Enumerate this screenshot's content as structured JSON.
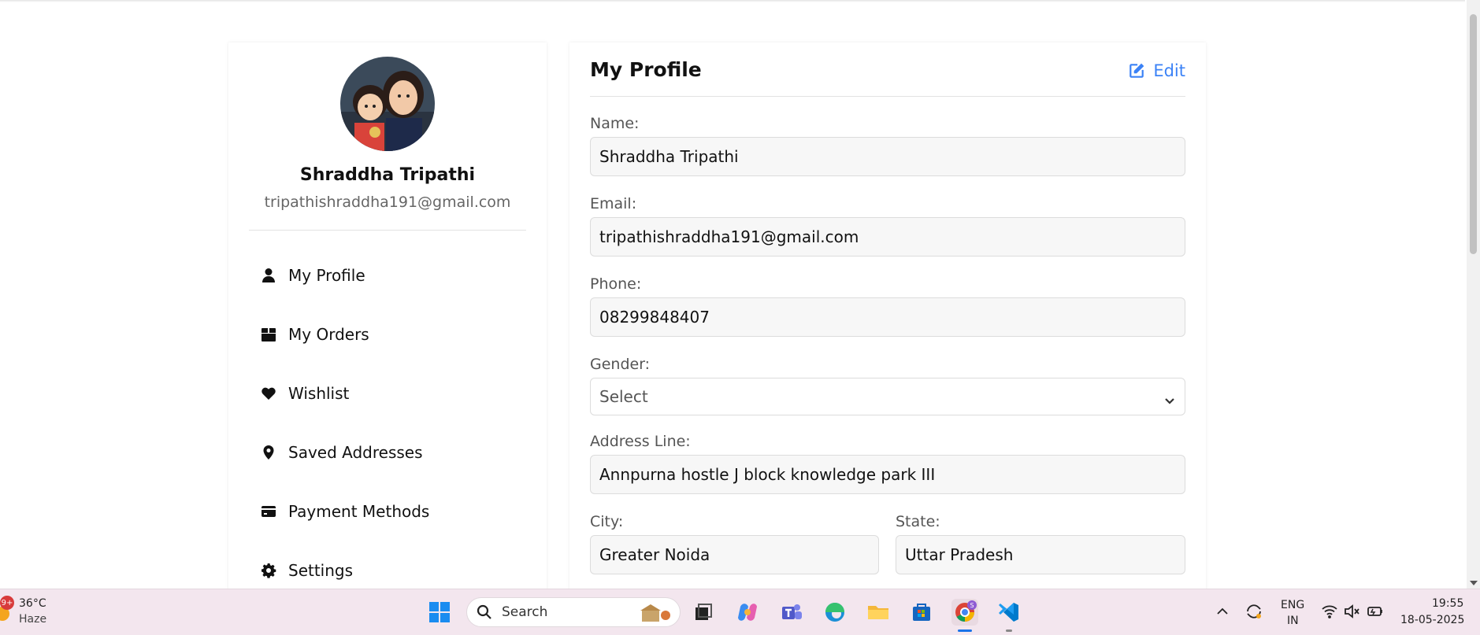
{
  "user": {
    "name": "Shraddha Tripathi",
    "email": "tripathishraddha191@gmail.com"
  },
  "sidebar": {
    "items": [
      {
        "label": "My Profile",
        "icon": "user-icon"
      },
      {
        "label": "My Orders",
        "icon": "box-icon"
      },
      {
        "label": "Wishlist",
        "icon": "heart-icon"
      },
      {
        "label": "Saved Addresses",
        "icon": "map-pin-icon"
      },
      {
        "label": "Payment Methods",
        "icon": "credit-card-icon"
      },
      {
        "label": "Settings",
        "icon": "gear-icon"
      }
    ]
  },
  "profile": {
    "title": "My Profile",
    "edit_label": "Edit",
    "fields": {
      "name": {
        "label": "Name:",
        "value": "Shraddha Tripathi"
      },
      "email": {
        "label": "Email:",
        "value": "tripathishraddha191@gmail.com"
      },
      "phone": {
        "label": "Phone:",
        "value": "08299848407"
      },
      "gender": {
        "label": "Gender:",
        "value": "Select"
      },
      "address": {
        "label": "Address Line:",
        "value": "Annpurna hostle J block knowledge park III"
      },
      "city": {
        "label": "City:",
        "value": "Greater Noida"
      },
      "state": {
        "label": "State:",
        "value": "Uttar Pradesh"
      }
    }
  },
  "colors": {
    "accent": "#3b82f6",
    "taskbar_bg": "#f3e6ee"
  },
  "taskbar": {
    "weather_badge": "9+",
    "temperature": "36°C",
    "condition": "Haze",
    "search_label": "Search",
    "chrome_badge": "S",
    "lang_line1": "ENG",
    "lang_line2": "IN",
    "time": "19:55",
    "date": "18-05-2025"
  }
}
